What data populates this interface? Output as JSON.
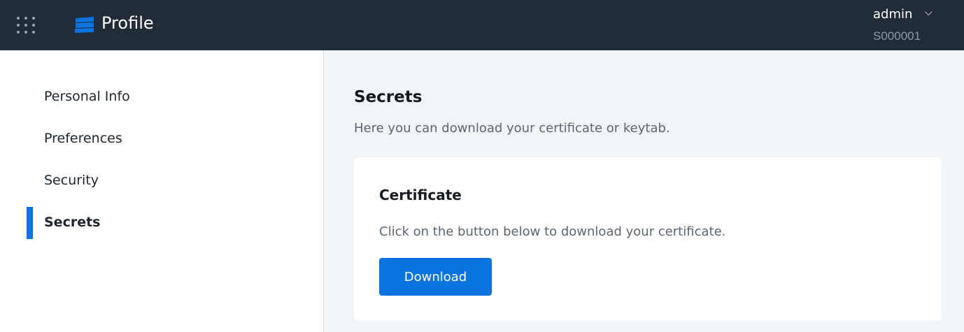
{
  "header": {
    "title": "Profile",
    "user": "admin",
    "user_id": "S000001"
  },
  "sidebar": {
    "items": [
      {
        "label": "Personal Info"
      },
      {
        "label": "Preferences"
      },
      {
        "label": "Security"
      },
      {
        "label": "Secrets"
      }
    ]
  },
  "main": {
    "title": "Secrets",
    "subtitle": "Here you can download your certificate or keytab.",
    "card": {
      "title": "Certificate",
      "text": "Click on the button below to download your certificate.",
      "button": "Download"
    }
  }
}
